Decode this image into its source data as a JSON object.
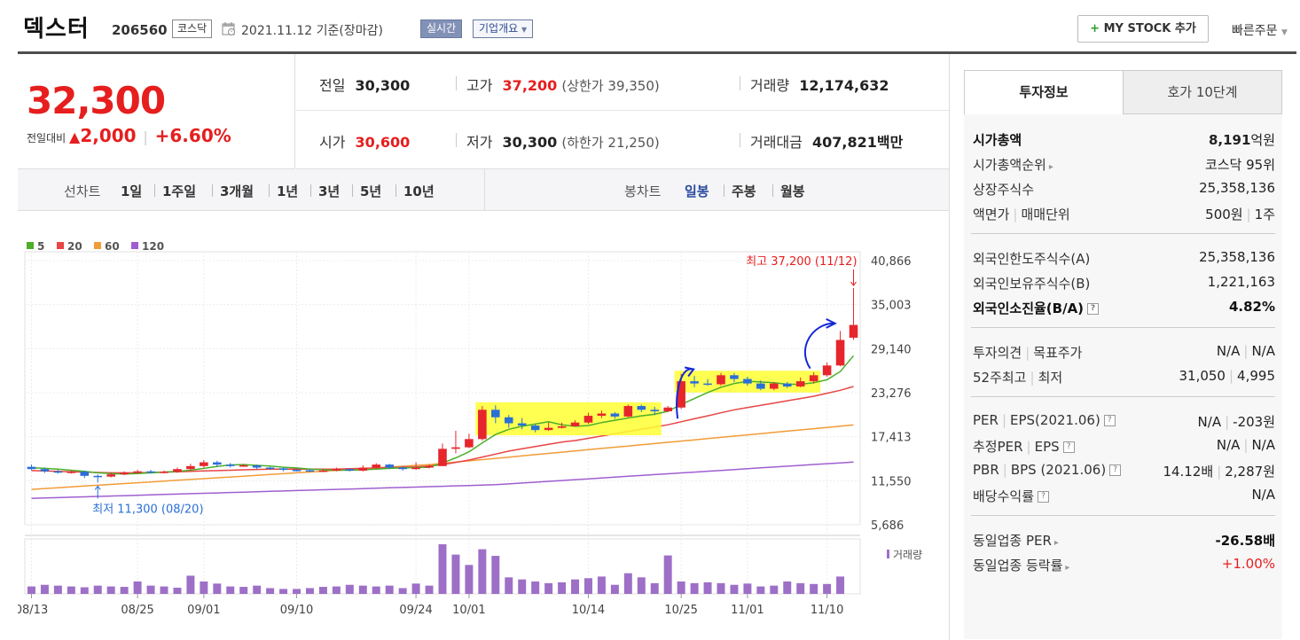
{
  "header": {
    "company": "덱스터",
    "code": "206560",
    "market": "코스닥",
    "date_text": "2021.11.12  기준(장마감)",
    "live_label": "실시간",
    "info_label": "기업개요",
    "mystock_label": "MY STOCK 추가",
    "quick_order_label": "빠른주문"
  },
  "price": {
    "current": "32,300",
    "prev_label": "전일대비",
    "change": "2,000",
    "change_pct": "+6.60%"
  },
  "stats": {
    "prev_close_label": "전일",
    "prev_close": "30,300",
    "high_label": "고가",
    "high": "37,200",
    "upper_limit": "(상한가 39,350)",
    "volume_label": "거래량",
    "volume": "12,174,632",
    "open_label": "시가",
    "open": "30,600",
    "low_label": "저가",
    "low": "30,300",
    "lower_limit": "(하한가 21,250)",
    "amount_label": "거래대금",
    "amount": "407,821",
    "amount_unit": "백만"
  },
  "period_bar": {
    "line_chart_label": "선차트",
    "periods": [
      "1일",
      "1주일",
      "3개월",
      "1년",
      "3년",
      "5년",
      "10년"
    ],
    "candle_label": "봉차트",
    "candle_periods": [
      "일봉",
      "주봉",
      "월봉"
    ],
    "active_candle": "일봉"
  },
  "chart_data": {
    "type": "candlestick",
    "legend": [
      {
        "name": "5",
        "color": "#4caf2a"
      },
      {
        "name": "20",
        "color": "#e84545"
      },
      {
        "name": "60",
        "color": "#f29c38"
      },
      {
        "name": "120",
        "color": "#9f5fd0"
      }
    ],
    "y_ticks": [
      "40,866",
      "35,003",
      "29,140",
      "23,276",
      "17,413",
      "11,550",
      "5,686"
    ],
    "ylim": [
      5686,
      40866
    ],
    "x_ticks": [
      "08/13",
      "08/25",
      "09/01",
      "09/10",
      "09/24",
      "10/01",
      "10/14",
      "10/25",
      "11/01",
      "11/10"
    ],
    "x_tick_index": [
      0,
      8,
      13,
      20,
      29,
      33,
      42,
      49,
      54,
      60
    ],
    "high_annotation": "최고 37,200 (11/12)",
    "low_annotation": "최저 11,300 (08/20)",
    "volume_label": "거래량",
    "up_color": "#e6262c",
    "down_color": "#2a6fd6",
    "candles": [
      [
        13400,
        13100,
        13700,
        12950
      ],
      [
        13100,
        12800,
        13300,
        12600
      ],
      [
        12800,
        12700,
        13000,
        12500
      ],
      [
        12700,
        12750,
        12900,
        12500
      ],
      [
        12750,
        12200,
        12900,
        11900
      ],
      [
        12200,
        12100,
        12400,
        11300
      ],
      [
        12100,
        12400,
        12600,
        12000
      ],
      [
        12400,
        12600,
        12800,
        12300
      ],
      [
        12600,
        12800,
        13000,
        12500
      ],
      [
        12800,
        12700,
        13000,
        12500
      ],
      [
        12700,
        12750,
        12900,
        12500
      ],
      [
        12750,
        13100,
        13300,
        12600
      ],
      [
        13100,
        13500,
        13800,
        12900
      ],
      [
        13500,
        14000,
        14300,
        13300
      ],
      [
        14000,
        13700,
        14200,
        13400
      ],
      [
        13700,
        13500,
        13900,
        13300
      ],
      [
        13500,
        13600,
        13800,
        13400
      ],
      [
        13600,
        13300,
        13700,
        13100
      ],
      [
        13300,
        13200,
        13400,
        13000
      ],
      [
        13200,
        13000,
        13300,
        12800
      ],
      [
        13000,
        12950,
        13200,
        12800
      ],
      [
        12950,
        12800,
        13100,
        12700
      ],
      [
        12800,
        12900,
        13100,
        12700
      ],
      [
        12900,
        13100,
        13300,
        12800
      ],
      [
        13100,
        12900,
        13200,
        12800
      ],
      [
        12900,
        13300,
        13600,
        12800
      ],
      [
        13300,
        13700,
        13900,
        13200
      ],
      [
        13700,
        13300,
        13800,
        13100
      ],
      [
        13300,
        13100,
        13500,
        12900
      ],
      [
        13100,
        13300,
        14000,
        13000
      ],
      [
        13300,
        13500,
        13700,
        13200
      ],
      [
        13500,
        15800,
        16500,
        13500
      ],
      [
        15800,
        16000,
        18200,
        15200
      ],
      [
        16000,
        17100,
        17800,
        15900
      ],
      [
        17100,
        21000,
        21500,
        16900
      ],
      [
        21000,
        20000,
        21600,
        19200
      ],
      [
        20000,
        19200,
        20300,
        18600
      ],
      [
        19200,
        18900,
        19900,
        18400
      ],
      [
        18900,
        18300,
        19100,
        18000
      ],
      [
        18300,
        18600,
        19300,
        18200
      ],
      [
        18600,
        18800,
        19300,
        18500
      ],
      [
        18800,
        19300,
        19600,
        18800
      ],
      [
        19300,
        20200,
        20600,
        19100
      ],
      [
        20200,
        20500,
        20900,
        19900
      ],
      [
        20500,
        20100,
        20700,
        19800
      ],
      [
        20100,
        21500,
        21700,
        20000
      ],
      [
        21500,
        21000,
        21700,
        20700
      ],
      [
        21000,
        20800,
        21400,
        20300
      ],
      [
        20800,
        21300,
        21500,
        20700
      ],
      [
        21300,
        24800,
        25800,
        21100
      ],
      [
        24800,
        24500,
        25500,
        24000
      ],
      [
        24500,
        24400,
        25100,
        24200
      ],
      [
        24400,
        25600,
        25900,
        24200
      ],
      [
        25600,
        25100,
        25900,
        24700
      ],
      [
        25100,
        24500,
        25400,
        24200
      ],
      [
        24500,
        23800,
        24900,
        23600
      ],
      [
        23800,
        24500,
        24700,
        23600
      ],
      [
        24500,
        24100,
        24700,
        23900
      ],
      [
        24100,
        24800,
        25300,
        24000
      ],
      [
        24800,
        25600,
        26000,
        24500
      ],
      [
        25600,
        26900,
        27300,
        25400
      ],
      [
        26900,
        30300,
        31500,
        26800
      ],
      [
        30600,
        32300,
        37200,
        30300
      ]
    ],
    "volumes": [
      18,
      22,
      20,
      18,
      16,
      20,
      18,
      17,
      30,
      20,
      18,
      15,
      44,
      30,
      25,
      18,
      17,
      20,
      14,
      12,
      12,
      14,
      17,
      18,
      22,
      20,
      18,
      20,
      14,
      25,
      20,
      120,
      95,
      70,
      108,
      92,
      40,
      35,
      30,
      26,
      28,
      35,
      38,
      42,
      22,
      50,
      40,
      26,
      93,
      30,
      26,
      28,
      26,
      22,
      25,
      18,
      20,
      30,
      26,
      24,
      24,
      42
    ],
    "ma5": [
      13300,
      13200,
      13100,
      12950,
      12800,
      12600,
      12500,
      12450,
      12500,
      12600,
      12700,
      12800,
      12950,
      13200,
      13450,
      13650,
      13700,
      13600,
      13500,
      13350,
      13250,
      13100,
      13000,
      12950,
      12950,
      13000,
      13100,
      13200,
      13250,
      13300,
      13350,
      13900,
      14600,
      15400,
      16600,
      17700,
      18400,
      18800,
      19100,
      19400,
      19000,
      18800,
      18900,
      19300,
      19600,
      19900,
      20200,
      20400,
      20800,
      21700,
      22500,
      23300,
      24000,
      24500,
      24800,
      24700,
      24600,
      24400,
      24400,
      24600,
      25000,
      26100,
      28200
    ],
    "ma20": [
      12900,
      12850,
      12800,
      12750,
      12700,
      12650,
      12600,
      12600,
      12600,
      12650,
      12700,
      12750,
      12800,
      12850,
      12900,
      12950,
      13000,
      13050,
      13100,
      13100,
      13100,
      13100,
      13100,
      13100,
      13150,
      13200,
      13250,
      13300,
      13350,
      13400,
      13500,
      13700,
      14000,
      14300,
      14700,
      15100,
      15500,
      15800,
      16100,
      16400,
      16700,
      16900,
      17200,
      17500,
      17800,
      18100,
      18400,
      18700,
      19000,
      19400,
      19800,
      20200,
      20600,
      21000,
      21300,
      21600,
      21900,
      22200,
      22500,
      22800,
      23200,
      23600,
      24100
    ]
  },
  "tabs": {
    "invest": "투자정보",
    "orderbook": "호가 10단계"
  },
  "info": {
    "market_cap_label": "시가총액",
    "market_cap": "8,191",
    "market_cap_unit": "억원",
    "cap_rank_label": "시가총액순위",
    "cap_rank": "코스닥 95위",
    "shares_label": "상장주식수",
    "shares": "25,358,136",
    "par_label": "액면가",
    "trade_unit_label": "매매단위",
    "par": "500원",
    "trade_unit": "1주",
    "foreign_limit_label": "외국인한도주식수(A)",
    "foreign_limit": "25,358,136",
    "foreign_hold_label": "외국인보유주식수(B)",
    "foreign_hold": "1,221,163",
    "foreign_ratio_label": "외국인소진율(B/A)",
    "foreign_ratio": "4.82%",
    "opinion_label": "투자의견",
    "target_label": "목표주가",
    "opinion": "N/A",
    "target": "N/A",
    "wk52_high_label": "52주최고",
    "wk52_low_label": "최저",
    "wk52_high": "31,050",
    "wk52_low": "4,995",
    "per_label": "PER",
    "eps_label": "EPS(2021.06)",
    "per": "N/A",
    "eps": "-203원",
    "est_per_label": "추정PER",
    "est_eps_label": "EPS",
    "est_per": "N/A",
    "est_eps": "N/A",
    "pbr_label": "PBR",
    "bps_label": "BPS (2021.06)",
    "pbr": "14.12배",
    "bps": "2,287원",
    "div_label": "배당수익률",
    "div": "N/A",
    "sector_per_label": "동일업종 PER",
    "sector_per": "-26.58배",
    "sector_chg_label": "동일업종 등락률",
    "sector_chg": "+1.00%"
  }
}
